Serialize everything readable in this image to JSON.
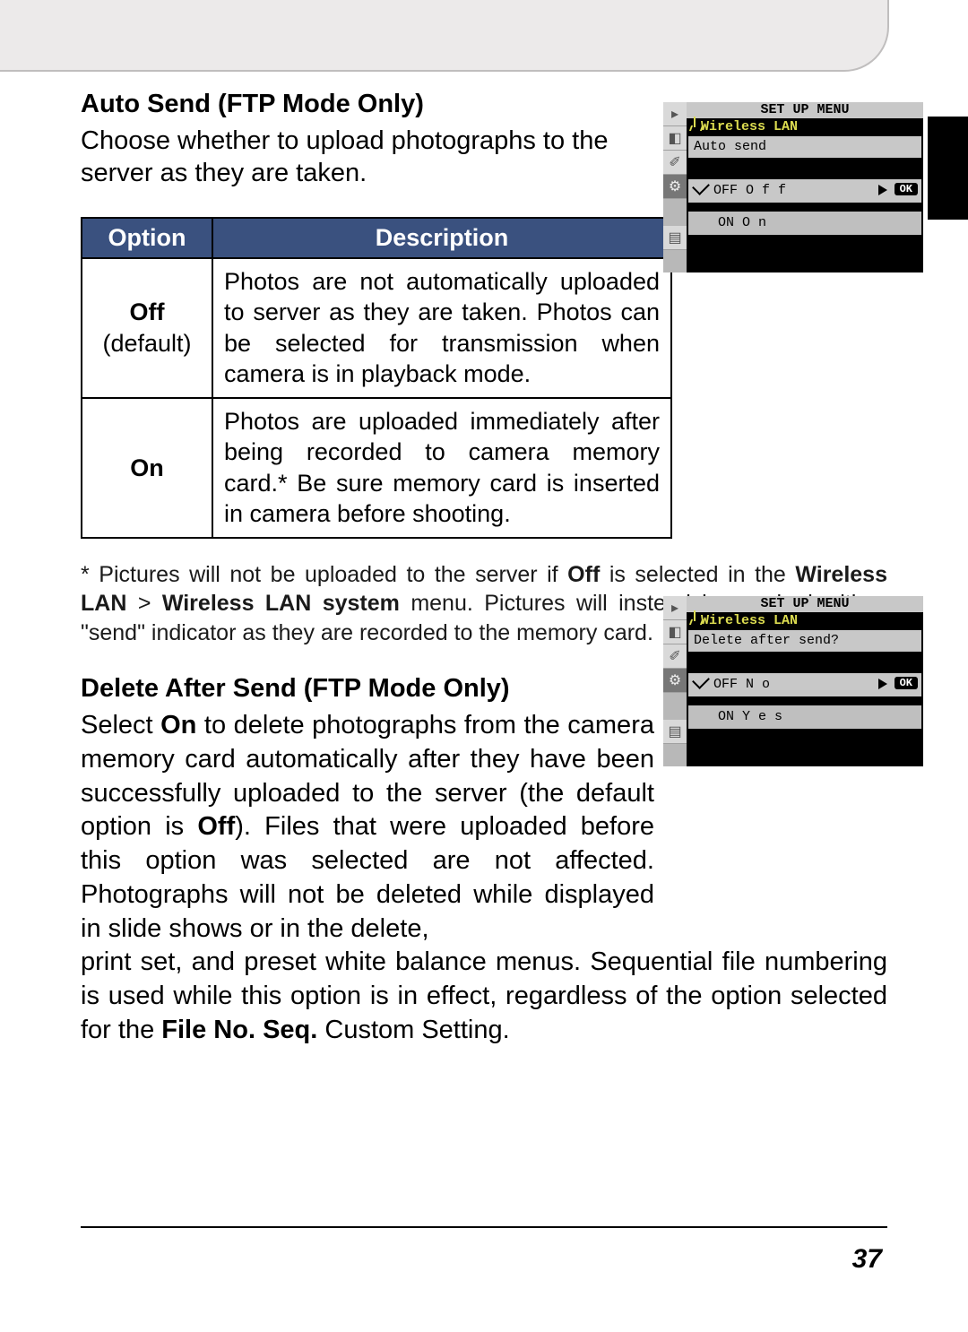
{
  "page_number": "37",
  "section1": {
    "heading": "Auto Send (FTP Mode Only)",
    "intro": "Choose whether to upload photographs to the server as they are taken."
  },
  "table": {
    "head_option": "Option",
    "head_desc": "Description",
    "row1_opt_bold": "Off",
    "row1_opt_sub": "(default)",
    "row1_desc": "Photos are not automatically uploaded to server as they are taken.  Photos can be selected for transmission when camera is in playback mode.",
    "row2_opt_bold": "On",
    "row2_desc": "Photos are uploaded immediately after being recorded to camera memory card.*  Be sure memory card is inserted in camera before shooting."
  },
  "footnote": {
    "pre": "* Pictures will not be uploaded to the server if ",
    "b1": "Off",
    "mid1": " is selected in the ",
    "b2": "Wireless LAN",
    "gt": " > ",
    "b3": "Wireless LAN system",
    "post": " menu.  Pictures will instead be marked with a \"send\" indicator as they are recorded to the memory card."
  },
  "section2": {
    "heading": "Delete After Send (FTP Mode Only)",
    "p1_a": "Select ",
    "p1_b1": "On",
    "p1_b": " to delete photographs from the camera memory card automatically after they have been successfully uploaded to the server (the default option is ",
    "p1_b2": "Off",
    "p1_c": ").  Files that were uploaded before this option was selected are not affected.  Photographs will not be deleted while displayed in slide shows or in the delete,",
    "p2_a": "print set, and preset white balance menus.  Sequential file numbering is used while this option is in effect, regardless of the option selected for the ",
    "p2_b1": "File No. Seq.",
    "p2_b": " Custom Setting."
  },
  "lcd1": {
    "title": "SET UP MENU",
    "sub": "Wireless LAN",
    "hdr": "Auto send",
    "row_off": "OFF  O f f",
    "row_on": "ON  O n",
    "ok": "OK"
  },
  "lcd2": {
    "title": "SET UP MENU",
    "sub": "Wireless LAN",
    "hdr": "Delete after send?",
    "row_off": "OFF  N o",
    "row_on": "ON  Y e s",
    "ok": "OK"
  }
}
